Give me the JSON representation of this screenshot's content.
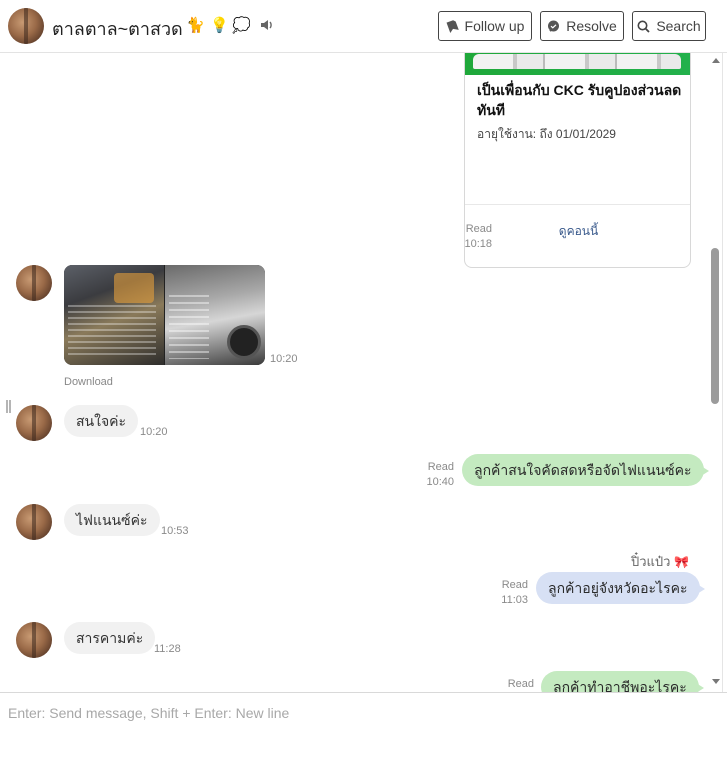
{
  "header": {
    "contact_name": "ตาลตาล~ตาสวด",
    "emojis": [
      "🐈",
      "💡",
      "💭"
    ],
    "follow_up_label": "Follow up",
    "resolve_label": "Resolve",
    "search_label": "Search"
  },
  "coupon": {
    "title": "เป็นเพื่อนกับ CKC รับคูปองส่วนลดทันที",
    "expiry": "อายุใช้งาน: ถึง 01/01/2029",
    "link_label": "ดูคอนนี้",
    "status": "Read",
    "time": "10:18"
  },
  "messages": [
    {
      "type": "image",
      "time": "10:20",
      "download_label": "Download"
    },
    {
      "type": "incoming",
      "text": "สนใจค่ะ",
      "time": "10:20"
    },
    {
      "type": "outgoing",
      "text": "ลูกค้าสนใจคัดสดหรือจัดไฟแนนซ์คะ",
      "status": "Read",
      "time": "10:40"
    },
    {
      "type": "incoming",
      "text": "ไฟแนนซ์ค่ะ",
      "time": "10:53"
    },
    {
      "type": "outgoing",
      "sender": "ปิ๋วแป๋ว",
      "sender_emoji": "🎀",
      "text": "ลูกค้าอยู่จังหวัดอะไรคะ",
      "status": "Read",
      "time": "11:03"
    },
    {
      "type": "incoming",
      "text": "สารคามค่ะ",
      "time": "11:28"
    },
    {
      "type": "outgoing",
      "text": "ลูกค้าทำอาชีพอะไรคะ",
      "status": "Read",
      "time": ""
    }
  ],
  "composer": {
    "placeholder": "Enter: Send message, Shift + Enter: New line"
  },
  "colors": {
    "outgoing_bubble": "#c4eac0",
    "staff_bubble": "#d7e0f4",
    "incoming_bubble": "#f1f1f1",
    "link": "#3a5a8c"
  }
}
